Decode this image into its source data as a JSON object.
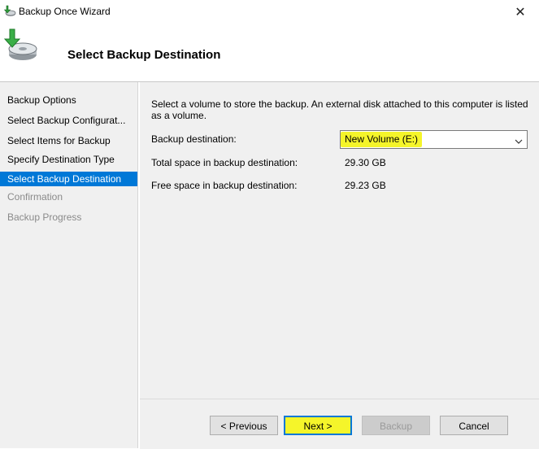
{
  "window": {
    "title": "Backup Once Wizard",
    "close_label": "✕"
  },
  "header": {
    "title": "Select Backup Destination",
    "icon": "backup-disk-icon"
  },
  "sidebar": {
    "items": [
      {
        "label": "Backup Options",
        "state": "normal"
      },
      {
        "label": "Select Backup Configurat...",
        "state": "normal"
      },
      {
        "label": "Select Items for Backup",
        "state": "normal"
      },
      {
        "label": "Specify Destination Type",
        "state": "normal"
      },
      {
        "label": "Select Backup Destination",
        "state": "selected"
      },
      {
        "label": "Confirmation",
        "state": "disabled"
      },
      {
        "label": "Backup Progress",
        "state": "disabled"
      }
    ]
  },
  "main": {
    "instruction": "Select a volume to store the backup. An external disk attached to this computer is listed as a volume.",
    "destination_label": "Backup destination:",
    "destination_value": "New Volume (E:)",
    "total_space_label": "Total space in backup destination:",
    "total_space_value": "29.30 GB",
    "free_space_label": "Free space in backup destination:",
    "free_space_value": "29.23 GB"
  },
  "buttons": {
    "previous": "< Previous",
    "next": "Next >",
    "backup": "Backup",
    "cancel": "Cancel"
  },
  "colors": {
    "accent": "#0078d7",
    "highlight": "#f5f52a",
    "panel": "#f0f0f0"
  }
}
